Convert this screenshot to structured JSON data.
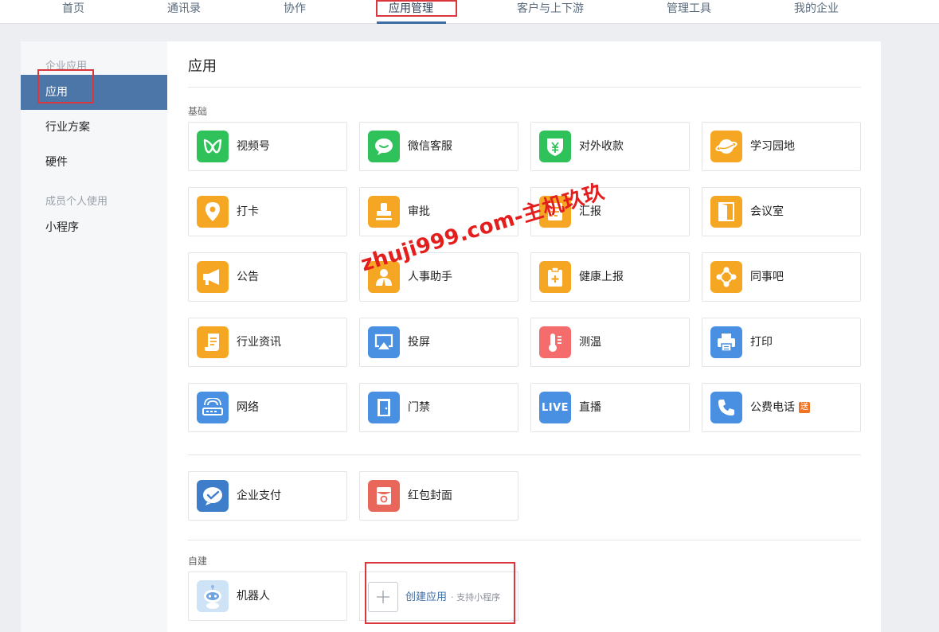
{
  "topnav": {
    "items": [
      {
        "id": "home",
        "label": "首页"
      },
      {
        "id": "contacts",
        "label": "通讯录"
      },
      {
        "id": "collab",
        "label": "协作"
      },
      {
        "id": "apps",
        "label": "应用管理",
        "active": true
      },
      {
        "id": "customers",
        "label": "客户与上下游"
      },
      {
        "id": "tools",
        "label": "管理工具"
      },
      {
        "id": "myco",
        "label": "我的企业"
      }
    ]
  },
  "sidebar": {
    "group1": "企业应用",
    "items1": [
      {
        "id": "apps",
        "label": "应用",
        "active": true
      },
      {
        "id": "industry",
        "label": "行业方案"
      },
      {
        "id": "hardware",
        "label": "硬件"
      }
    ],
    "group2": "成员个人使用",
    "items2": [
      {
        "id": "miniprogram",
        "label": "小程序"
      }
    ]
  },
  "main": {
    "title": "应用",
    "section_basic": "基础",
    "basic_apps": [
      {
        "id": "channels",
        "label": "视频号",
        "icon": "channels-icon",
        "color": "#2fc25b"
      },
      {
        "id": "wechat-service",
        "label": "微信客服",
        "icon": "chat-bubble-icon",
        "color": "#2fc25b"
      },
      {
        "id": "payment-collect",
        "label": "对外收款",
        "icon": "yen-shield-icon",
        "color": "#2fc25b"
      },
      {
        "id": "learning",
        "label": "学习园地",
        "icon": "planet-icon",
        "color": "#f5a623"
      },
      {
        "id": "checkin",
        "label": "打卡",
        "icon": "location-pin-icon",
        "color": "#f5a623"
      },
      {
        "id": "approval",
        "label": "审批",
        "icon": "stamp-icon",
        "color": "#f5a623"
      },
      {
        "id": "report",
        "label": "汇报",
        "icon": "document-icon",
        "color": "#f5a623"
      },
      {
        "id": "meeting-room",
        "label": "会议室",
        "icon": "door-icon",
        "color": "#f5a623"
      },
      {
        "id": "announcement",
        "label": "公告",
        "icon": "megaphone-icon",
        "color": "#f5a623"
      },
      {
        "id": "hr-assistant",
        "label": "人事助手",
        "icon": "person-icon",
        "color": "#f5a623"
      },
      {
        "id": "health-report",
        "label": "健康上报",
        "icon": "clipboard-plus-icon",
        "color": "#f5a623"
      },
      {
        "id": "colleague-bar",
        "label": "同事吧",
        "icon": "network-diamond-icon",
        "color": "#f5a623"
      },
      {
        "id": "industry-news",
        "label": "行业资讯",
        "icon": "scroll-icon",
        "color": "#f5a623"
      },
      {
        "id": "screen-cast",
        "label": "投屏",
        "icon": "airplay-icon",
        "color": "#4a90e2"
      },
      {
        "id": "temperature",
        "label": "测温",
        "icon": "thermometer-icon",
        "color": "#f56c6c"
      },
      {
        "id": "print",
        "label": "打印",
        "icon": "printer-icon",
        "color": "#4a90e2"
      },
      {
        "id": "network",
        "label": "网络",
        "icon": "router-icon",
        "color": "#4a90e2"
      },
      {
        "id": "access-control",
        "label": "门禁",
        "icon": "gate-door-icon",
        "color": "#4a90e2"
      },
      {
        "id": "live",
        "label": "直播",
        "icon": "live-icon",
        "color": "#4a90e2",
        "icon_text": "LIVE"
      },
      {
        "id": "public-phone",
        "label": "公费电话",
        "icon": "phone-icon",
        "color": "#4a90e2",
        "badge": "送"
      }
    ],
    "pay_apps": [
      {
        "id": "enterprise-pay",
        "label": "企业支付",
        "icon": "wechat-pay-icon",
        "color": "#3d7dca"
      },
      {
        "id": "red-packet",
        "label": "红包封面",
        "icon": "red-packet-icon",
        "color": "#e8665a"
      }
    ],
    "section_custom": "自建",
    "custom_apps": [
      {
        "id": "robot",
        "label": "机器人",
        "icon": "robot-icon",
        "color": "#cfe3f7"
      }
    ],
    "create": {
      "label": "创建应用",
      "sub": "· 支持小程序"
    }
  },
  "watermark": "zhuji999.com-主机玖玖"
}
